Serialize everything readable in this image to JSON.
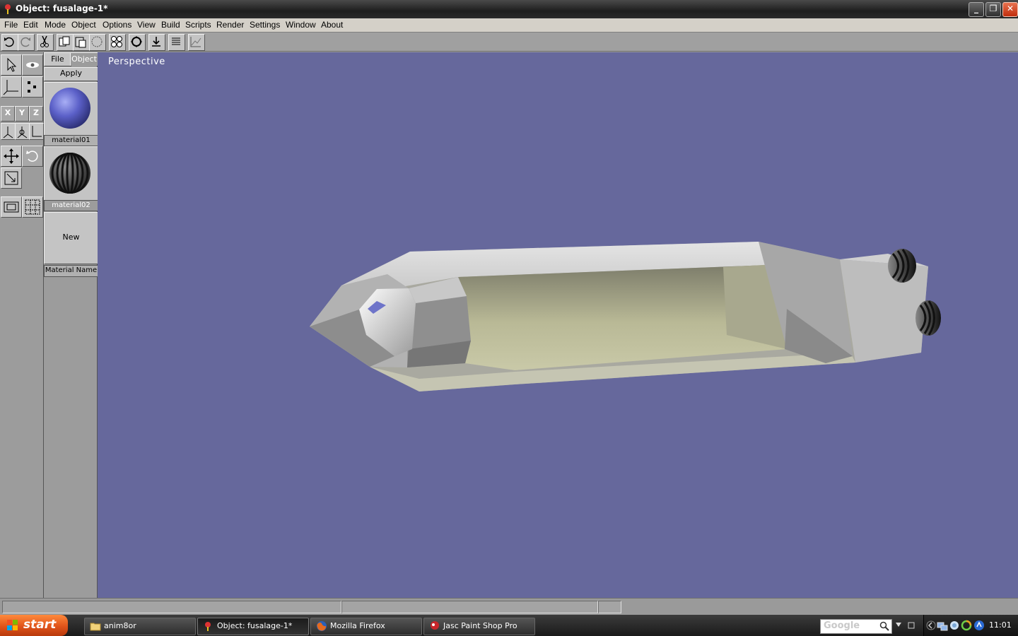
{
  "window": {
    "title": "Object: fusalage-1*",
    "minimize_label": "_",
    "restore_label": "❐",
    "close_label": "✕"
  },
  "menu": [
    "File",
    "Edit",
    "Mode",
    "Object",
    "Options",
    "View",
    "Build",
    "Scripts",
    "Render",
    "Settings",
    "Window",
    "About"
  ],
  "toolbar": {
    "icons": [
      "undo-icon",
      "redo-icon",
      "cut-icon",
      "copy-icon",
      "paste-icon",
      "select-all-icon",
      "view-four-icon",
      "view-frame-icon",
      "import-icon",
      "list-icon",
      "graph-icon"
    ]
  },
  "tools": {
    "axes": {
      "x": "X",
      "y": "Y",
      "z": "Z"
    }
  },
  "panel": {
    "tab_file": "File",
    "tab_object": "Object",
    "apply": "Apply",
    "materials": [
      {
        "name": "material01",
        "color": "#5b60c8"
      },
      {
        "name": "material02",
        "color": "#3a3a3a"
      }
    ],
    "new": "New",
    "material_name": "Material Name"
  },
  "viewport": {
    "label": "Perspective",
    "background": "#66689c"
  },
  "taskbar": {
    "start": "start",
    "items": [
      "anim8or",
      "Object: fusalage-1*",
      "Mozilla Firefox",
      "Jasc Paint Shop Pro"
    ],
    "search_text": "Google",
    "clock": "11:01"
  }
}
